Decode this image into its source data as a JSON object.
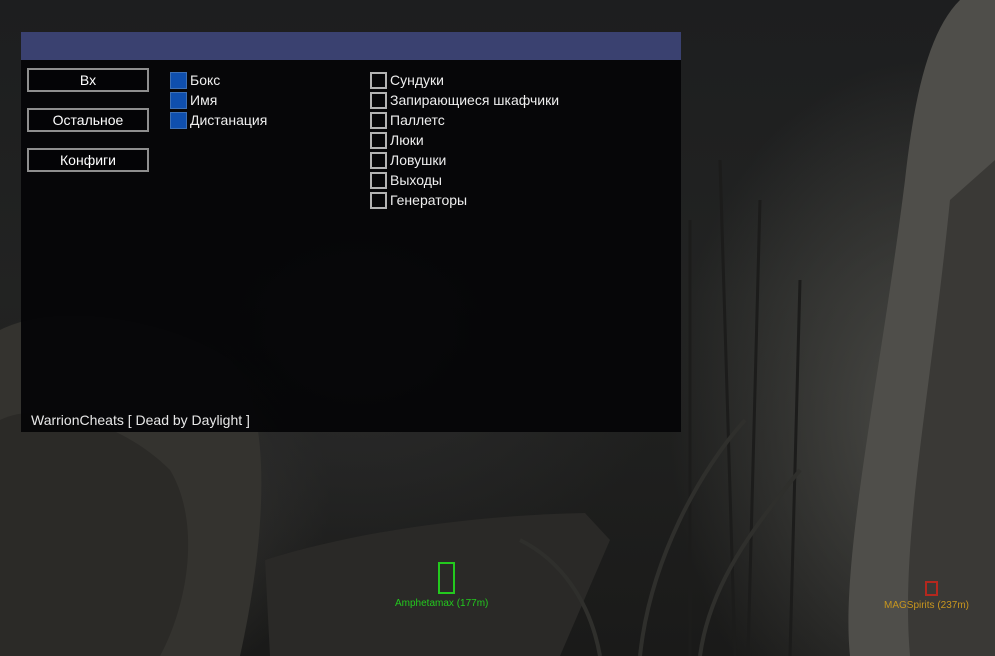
{
  "menu": {
    "tabs": [
      {
        "label": "Вх"
      },
      {
        "label": "Остальное"
      },
      {
        "label": "Конфиги"
      }
    ],
    "left_options": [
      {
        "label": "Бокс",
        "checked": true
      },
      {
        "label": "Имя",
        "checked": true
      },
      {
        "label": "Дистанация",
        "checked": true
      }
    ],
    "right_options": [
      {
        "label": "Сундуки",
        "checked": false
      },
      {
        "label": "Запирающиеся шкафчики",
        "checked": false
      },
      {
        "label": "Паллетс",
        "checked": false
      },
      {
        "label": "Люки",
        "checked": false
      },
      {
        "label": "Ловушки",
        "checked": false
      },
      {
        "label": "Выходы",
        "checked": false
      },
      {
        "label": "Генераторы",
        "checked": false
      }
    ],
    "footer": "WarrionCheats [ Dead by Daylight ]",
    "colors": {
      "titlebar": "#3a4170",
      "checked": "#0f4fae"
    }
  },
  "esp": [
    {
      "label": "Amphetamax (177m)",
      "color": "#23c81e"
    },
    {
      "label": "MAGSpirits (237m)",
      "color": "#c8961e",
      "box_color": "#b4281e"
    }
  ]
}
